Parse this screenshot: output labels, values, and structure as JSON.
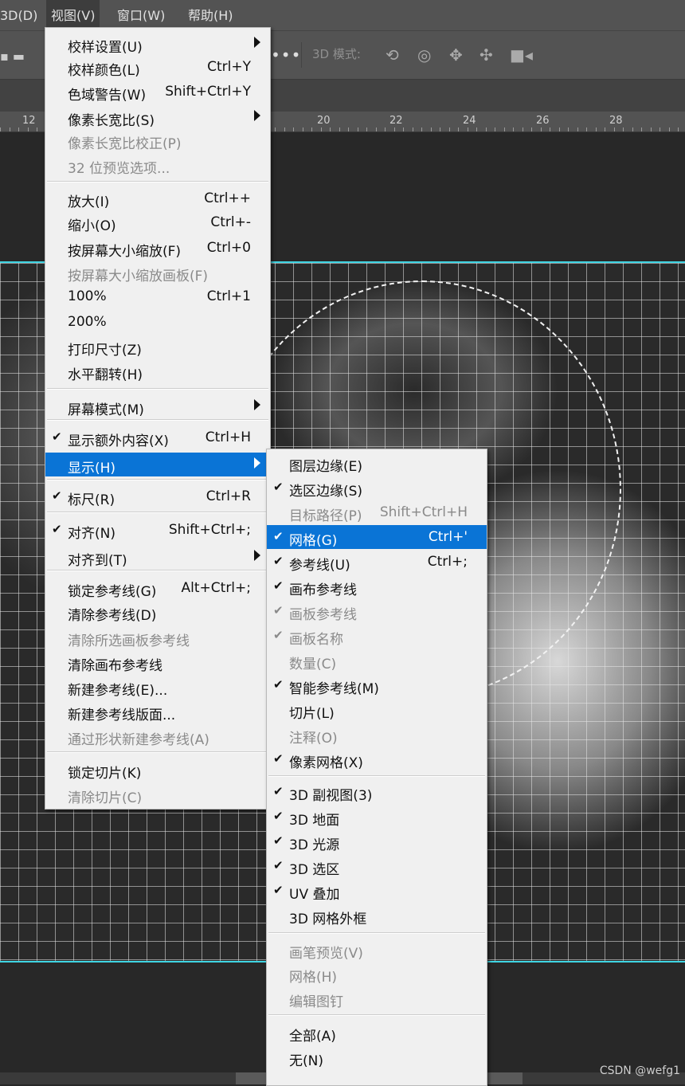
{
  "menubar": {
    "items": [
      {
        "label": "3D(D)"
      },
      {
        "label": "视图(V)"
      },
      {
        "label": "窗口(W)"
      },
      {
        "label": "帮助(H)"
      }
    ]
  },
  "options_bar": {
    "mode_label": "3D 模式:",
    "icons": [
      "rotate-3d-icon",
      "roll-3d-icon",
      "drag-3d-icon",
      "slide-3d-icon",
      "camera-3d-icon"
    ]
  },
  "ruler": {
    "labels": [
      "12",
      "20",
      "22",
      "24",
      "26",
      "28"
    ]
  },
  "view_menu": {
    "items": [
      {
        "label": "校样设置(U)",
        "shortcut": "",
        "submenu": true,
        "disabled": false,
        "checked": false
      },
      {
        "label": "校样颜色(L)",
        "shortcut": "Ctrl+Y",
        "disabled": false,
        "checked": false
      },
      {
        "label": "色域警告(W)",
        "shortcut": "Shift+Ctrl+Y",
        "disabled": false,
        "checked": false
      },
      {
        "label": "像素长宽比(S)",
        "shortcut": "",
        "submenu": true,
        "disabled": false,
        "checked": false
      },
      {
        "label": "像素长宽比校正(P)",
        "shortcut": "",
        "disabled": true,
        "checked": false
      },
      {
        "label": "32 位预览选项...",
        "shortcut": "",
        "disabled": true,
        "checked": false
      },
      {
        "label": "放大(I)",
        "shortcut": "Ctrl++",
        "disabled": false,
        "checked": false
      },
      {
        "label": "缩小(O)",
        "shortcut": "Ctrl+-",
        "disabled": false,
        "checked": false
      },
      {
        "label": "按屏幕大小缩放(F)",
        "shortcut": "Ctrl+0",
        "disabled": false,
        "checked": false
      },
      {
        "label": "按屏幕大小缩放画板(F)",
        "shortcut": "",
        "disabled": true,
        "checked": false
      },
      {
        "label": "100%",
        "shortcut": "Ctrl+1",
        "disabled": false,
        "checked": false
      },
      {
        "label": "200%",
        "shortcut": "",
        "disabled": false,
        "checked": false
      },
      {
        "label": "打印尺寸(Z)",
        "shortcut": "",
        "disabled": false,
        "checked": false
      },
      {
        "label": "水平翻转(H)",
        "shortcut": "",
        "disabled": false,
        "checked": false
      },
      {
        "label": "屏幕模式(M)",
        "shortcut": "",
        "submenu": true,
        "disabled": false,
        "checked": false
      },
      {
        "label": "显示额外内容(X)",
        "shortcut": "Ctrl+H",
        "disabled": false,
        "checked": true
      },
      {
        "label": "显示(H)",
        "shortcut": "",
        "submenu": true,
        "disabled": false,
        "checked": false,
        "highlighted": true
      },
      {
        "label": "标尺(R)",
        "shortcut": "Ctrl+R",
        "disabled": false,
        "checked": true
      },
      {
        "label": "对齐(N)",
        "shortcut": "Shift+Ctrl+;",
        "disabled": false,
        "checked": true
      },
      {
        "label": "对齐到(T)",
        "shortcut": "",
        "submenu": true,
        "disabled": false,
        "checked": false
      },
      {
        "label": "锁定参考线(G)",
        "shortcut": "Alt+Ctrl+;",
        "disabled": false,
        "checked": false
      },
      {
        "label": "清除参考线(D)",
        "shortcut": "",
        "disabled": false,
        "checked": false
      },
      {
        "label": "清除所选画板参考线",
        "shortcut": "",
        "disabled": true,
        "checked": false
      },
      {
        "label": "清除画布参考线",
        "shortcut": "",
        "disabled": false,
        "checked": false
      },
      {
        "label": "新建参考线(E)...",
        "shortcut": "",
        "disabled": false,
        "checked": false
      },
      {
        "label": "新建参考线版面...",
        "shortcut": "",
        "disabled": false,
        "checked": false
      },
      {
        "label": "通过形状新建参考线(A)",
        "shortcut": "",
        "disabled": true,
        "checked": false
      },
      {
        "label": "锁定切片(K)",
        "shortcut": "",
        "disabled": false,
        "checked": false
      },
      {
        "label": "清除切片(C)",
        "shortcut": "",
        "disabled": true,
        "checked": false
      }
    ]
  },
  "show_submenu": {
    "items": [
      {
        "label": "图层边缘(E)",
        "shortcut": "",
        "disabled": false,
        "checked": false
      },
      {
        "label": "选区边缘(S)",
        "shortcut": "",
        "disabled": false,
        "checked": true
      },
      {
        "label": "目标路径(P)",
        "shortcut": "Shift+Ctrl+H",
        "disabled": true,
        "checked": false
      },
      {
        "label": "网格(G)",
        "shortcut": "Ctrl+'",
        "disabled": false,
        "checked": true,
        "highlighted": true
      },
      {
        "label": "参考线(U)",
        "shortcut": "Ctrl+;",
        "disabled": false,
        "checked": true
      },
      {
        "label": "画布参考线",
        "shortcut": "",
        "disabled": false,
        "checked": true
      },
      {
        "label": "画板参考线",
        "shortcut": "",
        "disabled": true,
        "checked": true
      },
      {
        "label": "画板名称",
        "shortcut": "",
        "disabled": true,
        "checked": true
      },
      {
        "label": "数量(C)",
        "shortcut": "",
        "disabled": true,
        "checked": false
      },
      {
        "label": "智能参考线(M)",
        "shortcut": "",
        "disabled": false,
        "checked": true
      },
      {
        "label": "切片(L)",
        "shortcut": "",
        "disabled": false,
        "checked": false
      },
      {
        "label": "注释(O)",
        "shortcut": "",
        "disabled": true,
        "checked": false
      },
      {
        "label": "像素网格(X)",
        "shortcut": "",
        "disabled": false,
        "checked": true
      },
      {
        "label": "3D 副视图(3)",
        "shortcut": "",
        "disabled": false,
        "checked": true
      },
      {
        "label": "3D 地面",
        "shortcut": "",
        "disabled": false,
        "checked": true
      },
      {
        "label": "3D 光源",
        "shortcut": "",
        "disabled": false,
        "checked": true
      },
      {
        "label": "3D 选区",
        "shortcut": "",
        "disabled": false,
        "checked": true
      },
      {
        "label": "UV 叠加",
        "shortcut": "",
        "disabled": false,
        "checked": true
      },
      {
        "label": "3D 网格外框",
        "shortcut": "",
        "disabled": false,
        "checked": false
      },
      {
        "label": "画笔预览(V)",
        "shortcut": "",
        "disabled": true,
        "checked": false
      },
      {
        "label": "网格(H)",
        "shortcut": "",
        "disabled": true,
        "checked": false
      },
      {
        "label": "编辑图钉",
        "shortcut": "",
        "disabled": true,
        "checked": false
      },
      {
        "label": "全部(A)",
        "shortcut": "",
        "disabled": false,
        "checked": false
      },
      {
        "label": "无(N)",
        "shortcut": "",
        "disabled": false,
        "checked": false
      }
    ]
  },
  "watermark": "CSDN @wefg1",
  "colors": {
    "highlight": "#0a74d6",
    "guide": "#3fd6e4",
    "menu_bg": "#f0f0f0"
  }
}
